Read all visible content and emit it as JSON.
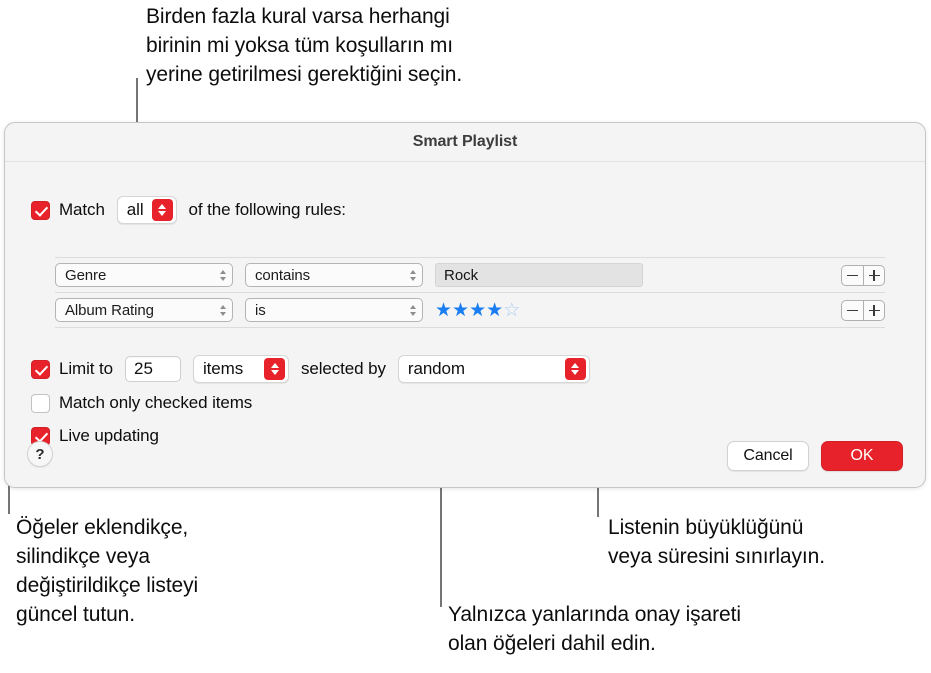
{
  "callouts": {
    "top": "Birden fazla kural varsa herhangi\nbirinin mi yoksa tüm koşulların mı\nyerine getirilmesi gerektiğini seçin.",
    "bottom_left": "Öğeler eklendikçe,\nsilindikçe veya\ndeğiştirildikçe listeyi\ngüncel tutun.",
    "bottom_right": "Listenin büyüklüğünü\nveya süresini sınırlayın.",
    "bottom_center": "Yalnızca yanlarında onay işareti\nolan öğeleri dahil edin."
  },
  "dialog": {
    "title": "Smart Playlist",
    "match": {
      "checked": true,
      "prefix_label": "Match",
      "scope_value": "all",
      "suffix_label": "of the following rules:"
    },
    "rules": [
      {
        "field": "Genre",
        "operator": "contains",
        "value_type": "text",
        "value": "Rock",
        "remove_label": "−",
        "add_label": "+"
      },
      {
        "field": "Album Rating",
        "operator": "is",
        "value_type": "stars",
        "stars_filled": 4,
        "stars_total": 5,
        "remove_label": "−",
        "add_label": "+"
      }
    ],
    "limit": {
      "checked": true,
      "label": "Limit to",
      "amount": "25",
      "unit": "items",
      "selected_by_label": "selected by",
      "selected_by_value": "random"
    },
    "match_only_checked": {
      "checked": false,
      "label": "Match only checked items"
    },
    "live_updating": {
      "checked": true,
      "label": "Live updating"
    },
    "help_label": "?",
    "cancel_label": "Cancel",
    "ok_label": "OK"
  },
  "colors": {
    "accent_red": "#e8222a",
    "star_blue": "#1a7ef2",
    "star_empty_blue": "#a9cdf5",
    "leader_gray": "#757575",
    "dialog_bg": "#f4f4f4"
  },
  "glyphs": {
    "star_full": "★",
    "star_empty": "☆"
  }
}
